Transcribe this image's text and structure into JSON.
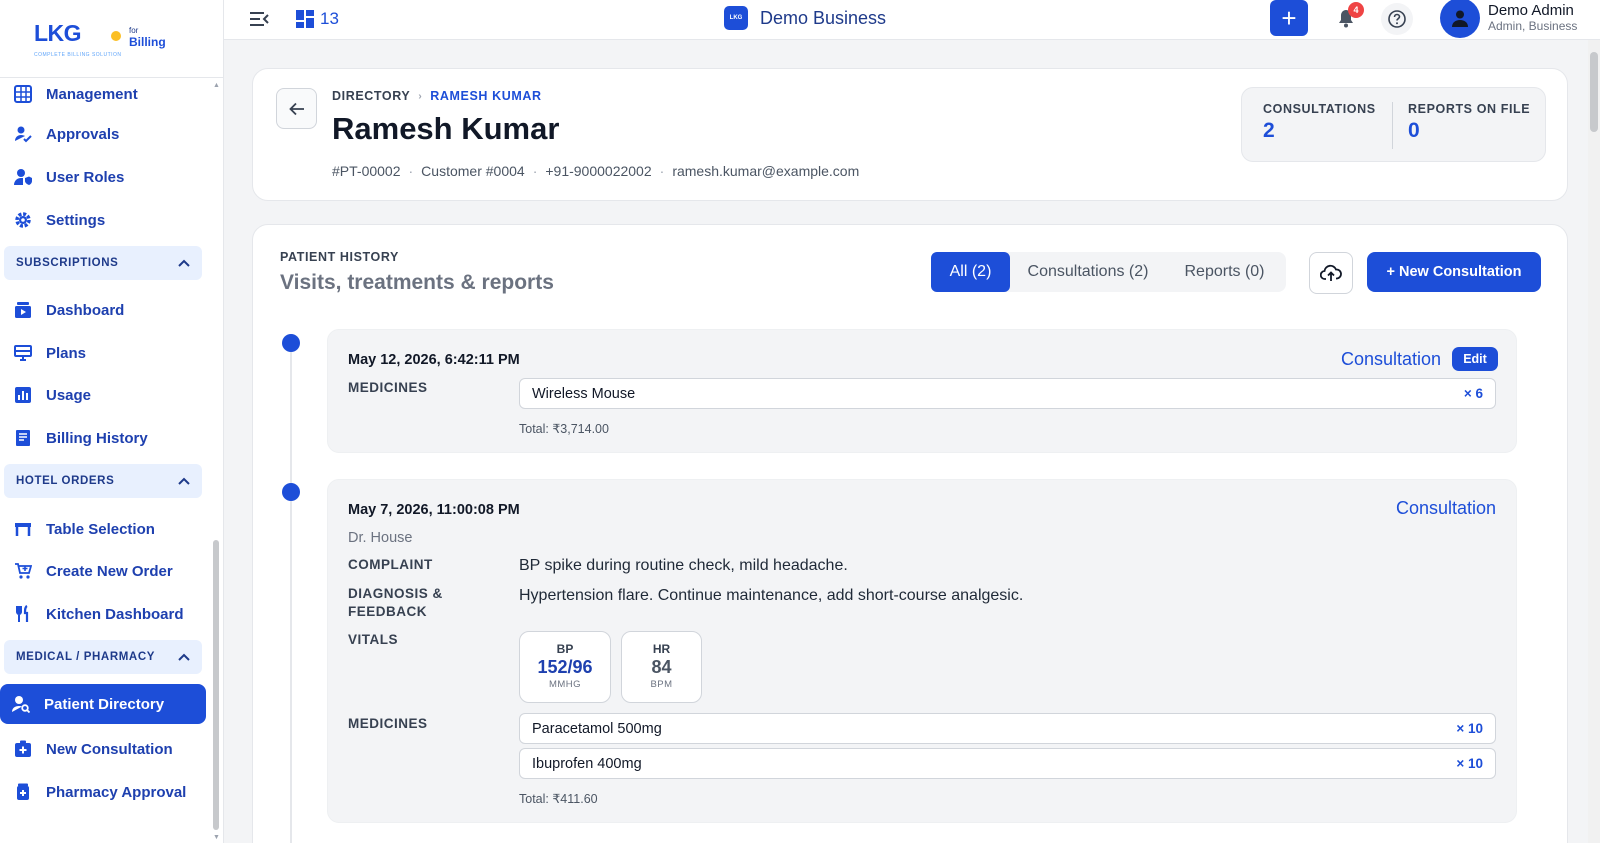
{
  "brand": {
    "logo_text": "LKG",
    "for_text": "for",
    "billing_text": "Billing",
    "tagline": "COMPLETE BILLING SOLUTION"
  },
  "sidebar": {
    "items_top": [
      {
        "label": "Management",
        "icon": "management-grid-icon"
      },
      {
        "label": "Approvals",
        "icon": "user-check-icon"
      },
      {
        "label": "User Roles",
        "icon": "shield-user-icon"
      },
      {
        "label": "Settings",
        "icon": "gear-icon"
      }
    ],
    "sections": [
      {
        "label": "SUBSCRIPTIONS",
        "items": [
          {
            "label": "Dashboard",
            "icon": "dashboard-icon"
          },
          {
            "label": "Plans",
            "icon": "monitor-icon"
          },
          {
            "label": "Usage",
            "icon": "bar-chart-icon"
          },
          {
            "label": "Billing History",
            "icon": "receipt-icon"
          }
        ]
      },
      {
        "label": "HOTEL ORDERS",
        "items": [
          {
            "label": "Table Selection",
            "icon": "table-icon"
          },
          {
            "label": "Create New Order",
            "icon": "cart-add-icon"
          },
          {
            "label": "Kitchen Dashboard",
            "icon": "utensils-icon"
          }
        ]
      },
      {
        "label": "MEDICAL / PHARMACY",
        "items": [
          {
            "label": "Patient Directory",
            "icon": "user-search-icon",
            "active": true
          },
          {
            "label": "New Consultation",
            "icon": "medical-plus-icon"
          },
          {
            "label": "Pharmacy Approval",
            "icon": "pharmacy-icon"
          }
        ]
      }
    ]
  },
  "topbar": {
    "grid_count": "13",
    "business_logo": "LKG",
    "business_name": "Demo Business",
    "notification_count": "4",
    "user_name": "Demo Admin",
    "user_role": "Admin, Business"
  },
  "header": {
    "crumb_parent": "DIRECTORY",
    "crumb_current": "RAMESH KUMAR",
    "patient_name": "Ramesh Kumar",
    "patient_id": "#PT-00002",
    "customer_no": "Customer #0004",
    "phone": "+91-9000022002",
    "email": "ramesh.kumar@example.com",
    "stats": [
      {
        "label": "CONSULTATIONS",
        "value": "2"
      },
      {
        "label": "REPORTS ON FILE",
        "value": "0"
      }
    ]
  },
  "history": {
    "kicker": "PATIENT HISTORY",
    "title": "Visits, treatments & reports",
    "filters": [
      {
        "label": "All (2)",
        "active": true
      },
      {
        "label": "Consultations (2)",
        "active": false
      },
      {
        "label": "Reports (0)",
        "active": false
      }
    ],
    "new_button": "+ New Consultation",
    "entries": [
      {
        "date": "May 12, 2026, 6:42:11 PM",
        "type": "Consultation",
        "edit_label": "Edit",
        "medicines_label": "MEDICINES",
        "medicines": [
          {
            "name": "Wireless Mouse",
            "qty": "× 6"
          }
        ],
        "total": "Total: ₹3,714.00"
      },
      {
        "date": "May 7, 2026, 11:00:08 PM",
        "type": "Consultation",
        "doctor": "Dr. House",
        "complaint_label": "COMPLAINT",
        "complaint": "BP spike during routine check, mild headache.",
        "diagnosis_label_1": "DIAGNOSIS &",
        "diagnosis_label_2": "FEEDBACK",
        "diagnosis": "Hypertension flare. Continue maintenance, add short-course analgesic.",
        "vitals_label": "VITALS",
        "vitals": [
          {
            "key": "BP",
            "value": "152/96",
            "unit": "MMHG",
            "color": "#1e40af"
          },
          {
            "key": "HR",
            "value": "84",
            "unit": "BPM",
            "color": "#4b5563"
          }
        ],
        "medicines_label": "MEDICINES",
        "medicines": [
          {
            "name": "Paracetamol 500mg",
            "qty": "× 10"
          },
          {
            "name": "Ibuprofen 400mg",
            "qty": "× 10"
          }
        ],
        "total": "Total: ₹411.60"
      }
    ]
  },
  "colors": {
    "primary": "#1d4ed8",
    "badge": "#ef4444"
  }
}
